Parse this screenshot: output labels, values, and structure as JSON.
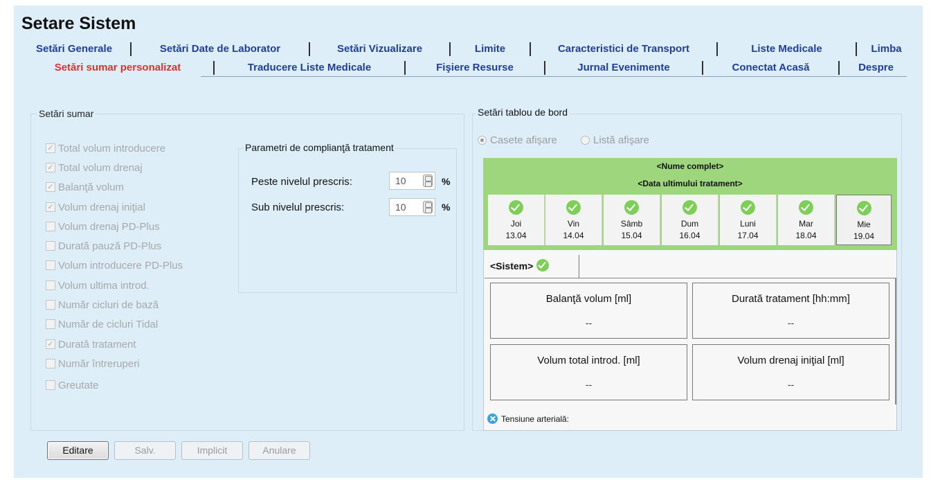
{
  "title": "Setare Sistem",
  "tabs_row1": [
    {
      "label": "Setări Generale"
    },
    {
      "label": "Setări Date de Laborator"
    },
    {
      "label": "Setări Vizualizare"
    },
    {
      "label": "Limite"
    },
    {
      "label": "Caracteristici de Transport"
    },
    {
      "label": "Liste Medicale"
    },
    {
      "label": "Limba"
    }
  ],
  "tabs_row2": [
    {
      "label": "Setări sumar personalizat",
      "active": true
    },
    {
      "label": "Traducere Liste Medicale"
    },
    {
      "label": "Fişiere Resurse"
    },
    {
      "label": "Jurnal Evenimente"
    },
    {
      "label": "Conectat Acasă"
    },
    {
      "label": "Despre"
    }
  ],
  "summary": {
    "title": "Setări sumar",
    "items": [
      {
        "label": "Total volum introducere",
        "checked": true
      },
      {
        "label": "Total volum drenaj",
        "checked": true
      },
      {
        "label": "Balanţă volum",
        "checked": true
      },
      {
        "label": "Volum drenaj iniţial",
        "checked": true
      },
      {
        "label": "Volum drenaj PD-Plus",
        "checked": false
      },
      {
        "label": "Durată pauză PD-Plus",
        "checked": false
      },
      {
        "label": "Volum introducere PD-Plus",
        "checked": false
      },
      {
        "label": "Volum ultima introd.",
        "checked": false
      },
      {
        "label": "Număr cicluri de bază",
        "checked": false
      },
      {
        "label": "Număr de cicluri Tidal",
        "checked": false
      },
      {
        "label": "Durată tratament",
        "checked": true
      },
      {
        "label": "Număr întreruperi",
        "checked": false
      },
      {
        "label": "Greutate",
        "checked": false
      }
    ]
  },
  "compliance": {
    "title": "Parametri de complianţă tratament",
    "above_label": "Peste nivelul prescris:",
    "above_value": "10",
    "below_label": "Sub nivelul prescris:",
    "below_value": "10",
    "unit": "%"
  },
  "dashboard": {
    "title": "Setări tablou de bord",
    "radio_tiles": "Casete afişare",
    "radio_list": "Listă afişare",
    "selected_radio": "tiles",
    "patient_name": "<Nume complet>",
    "last_treatment": "<Data ultimului tratament>",
    "days": [
      {
        "name": "Joi",
        "date": "13.04"
      },
      {
        "name": "Vin",
        "date": "14.04"
      },
      {
        "name": "Sâmb",
        "date": "15.04"
      },
      {
        "name": "Dum",
        "date": "16.04"
      },
      {
        "name": "Luni",
        "date": "17.04"
      },
      {
        "name": "Mar",
        "date": "18.04"
      },
      {
        "name": "Mie",
        "date": "19.04"
      }
    ],
    "selected_day_index": 6,
    "system_tab": "<Sistem>",
    "metrics": [
      {
        "label": "Balanţă volum [ml]",
        "value": "--"
      },
      {
        "label": "Durată tratament [hh:mm]",
        "value": "--"
      },
      {
        "label": "Volum total introd. [ml]",
        "value": "--"
      },
      {
        "label": "Volum drenaj iniţial [ml]",
        "value": "--"
      }
    ],
    "blood_pressure": "Tensiune arterială:"
  },
  "buttons": {
    "edit": "Editare",
    "save": "Salv.",
    "default": "Implicit",
    "cancel": "Anulare"
  },
  "colors": {
    "background": "#deeef9",
    "tab_text": "#1f3e9a",
    "active_tab": "#d9342b",
    "green_header": "#9ed67d",
    "check_green": "#7dcf58"
  }
}
